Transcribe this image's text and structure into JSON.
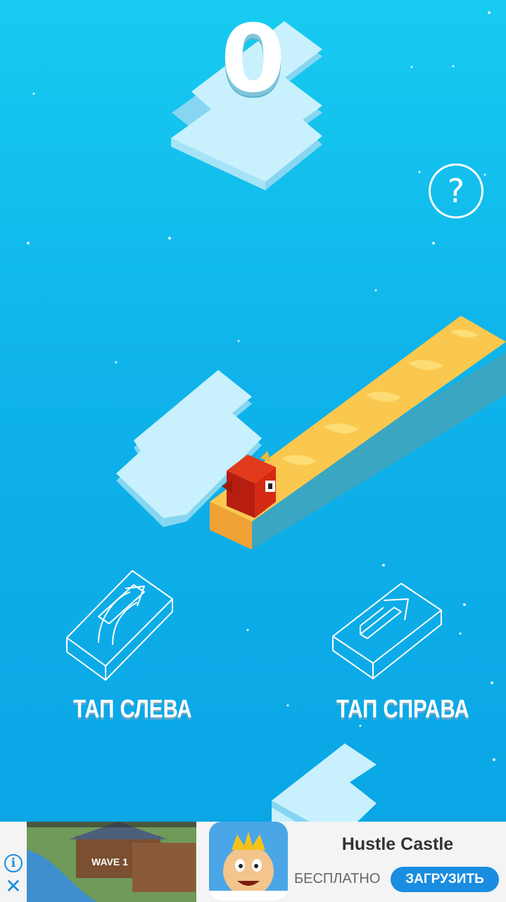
{
  "game": {
    "score": "0",
    "help_symbol": "?",
    "tap_left_label": "ТАП СЛЕВА",
    "tap_right_label": "ТАП СПРАВА",
    "colors": {
      "ice_top": "#c8f1fd",
      "ice_side": "#86d6f2",
      "sand_top": "#fbc84f",
      "sand_side": "#36b3b5",
      "player": "#d42a14",
      "background": "#0fb3ea"
    },
    "icons": [
      "help-icon",
      "turn-left-hint-icon",
      "go-straight-hint-icon",
      "player-bird-icon"
    ]
  },
  "ad": {
    "app_name": "Hustle Castle",
    "price": "БЕСПЛАТНО",
    "install_label": "ЗАГРУЗИТЬ",
    "screenshot_text": "WAVE 1",
    "info_symbol": "i",
    "close_symbol": "✕",
    "accent_color": "#1a8de0"
  }
}
